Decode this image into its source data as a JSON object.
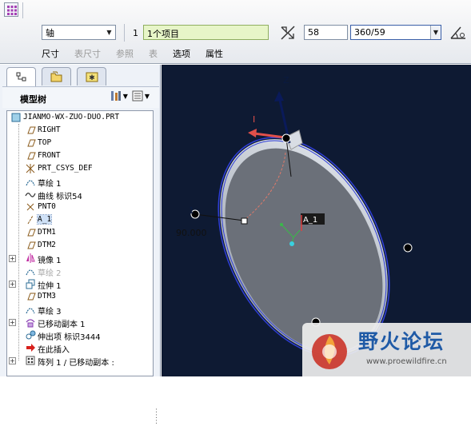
{
  "dashboard": {
    "type_value": "轴",
    "ref_count": "1",
    "ref_value": "1个项目",
    "angle_value": "58",
    "increment_value": "360/59",
    "tabs": [
      {
        "label": "尺寸",
        "enabled": true
      },
      {
        "label": "表尺寸",
        "enabled": false
      },
      {
        "label": "参照",
        "enabled": false
      },
      {
        "label": "表",
        "enabled": false
      },
      {
        "label": "选项",
        "enabled": true
      },
      {
        "label": "属性",
        "enabled": true
      }
    ]
  },
  "navigator": {
    "title": "模型树",
    "tree": [
      {
        "label": "JIANMO-WX-ZUO-DUO.PRT",
        "icon": "part-icon",
        "indent": 0,
        "expander": "",
        "state": "normal"
      },
      {
        "label": "RIGHT",
        "icon": "datum-plane-icon",
        "indent": 1,
        "expander": "",
        "state": "normal"
      },
      {
        "label": "TOP",
        "icon": "datum-plane-icon",
        "indent": 1,
        "expander": "",
        "state": "normal"
      },
      {
        "label": "FRONT",
        "icon": "datum-plane-icon",
        "indent": 1,
        "expander": "",
        "state": "normal"
      },
      {
        "label": "PRT_CSYS_DEF",
        "icon": "csys-icon",
        "indent": 1,
        "expander": "",
        "state": "normal"
      },
      {
        "label": "草绘 1",
        "icon": "sketch-icon",
        "indent": 1,
        "expander": "",
        "state": "normal"
      },
      {
        "label": "曲线 标识54",
        "icon": "curve-icon",
        "indent": 1,
        "expander": "",
        "state": "normal"
      },
      {
        "label": "PNT0",
        "icon": "datum-point-icon",
        "indent": 1,
        "expander": "",
        "state": "normal"
      },
      {
        "label": "A_1",
        "icon": "datum-axis-icon",
        "indent": 1,
        "expander": "",
        "state": "selected"
      },
      {
        "label": "DTM1",
        "icon": "datum-plane-icon",
        "indent": 1,
        "expander": "",
        "state": "normal"
      },
      {
        "label": "DTM2",
        "icon": "datum-plane-icon",
        "indent": 1,
        "expander": "",
        "state": "normal"
      },
      {
        "label": "镜像 1",
        "icon": "mirror-icon",
        "indent": 1,
        "expander": "+",
        "state": "normal"
      },
      {
        "label": "草绘 2",
        "icon": "sketch-icon",
        "indent": 1,
        "expander": "",
        "state": "dim"
      },
      {
        "label": "拉伸 1",
        "icon": "extrude-icon",
        "indent": 1,
        "expander": "+",
        "state": "normal"
      },
      {
        "label": "DTM3",
        "icon": "datum-plane-icon",
        "indent": 1,
        "expander": "",
        "state": "normal"
      },
      {
        "label": "草绘 3",
        "icon": "sketch-icon",
        "indent": 1,
        "expander": "",
        "state": "normal"
      },
      {
        "label": "已移动副本 1",
        "icon": "moved-copy-icon",
        "indent": 1,
        "expander": "+",
        "state": "normal"
      },
      {
        "label": "伸出项 标识3444",
        "icon": "protrusion-icon",
        "indent": 1,
        "expander": "",
        "state": "normal"
      },
      {
        "label": "在此插入",
        "icon": "insert-here-icon",
        "indent": 1,
        "expander": "",
        "state": "normal"
      },
      {
        "label": "阵列 1 / 已移动副本 :",
        "icon": "pattern-icon",
        "indent": 1,
        "expander": "+",
        "state": "normal"
      }
    ]
  },
  "viewport": {
    "axis_label_z": "Z",
    "axis_label_1": "1",
    "dimension_label": "90.000",
    "axis_tag": "A_1",
    "dim_label_i": "I"
  },
  "watermark": {
    "text": "野火论坛",
    "url": "www.proewildfire.cn"
  }
}
